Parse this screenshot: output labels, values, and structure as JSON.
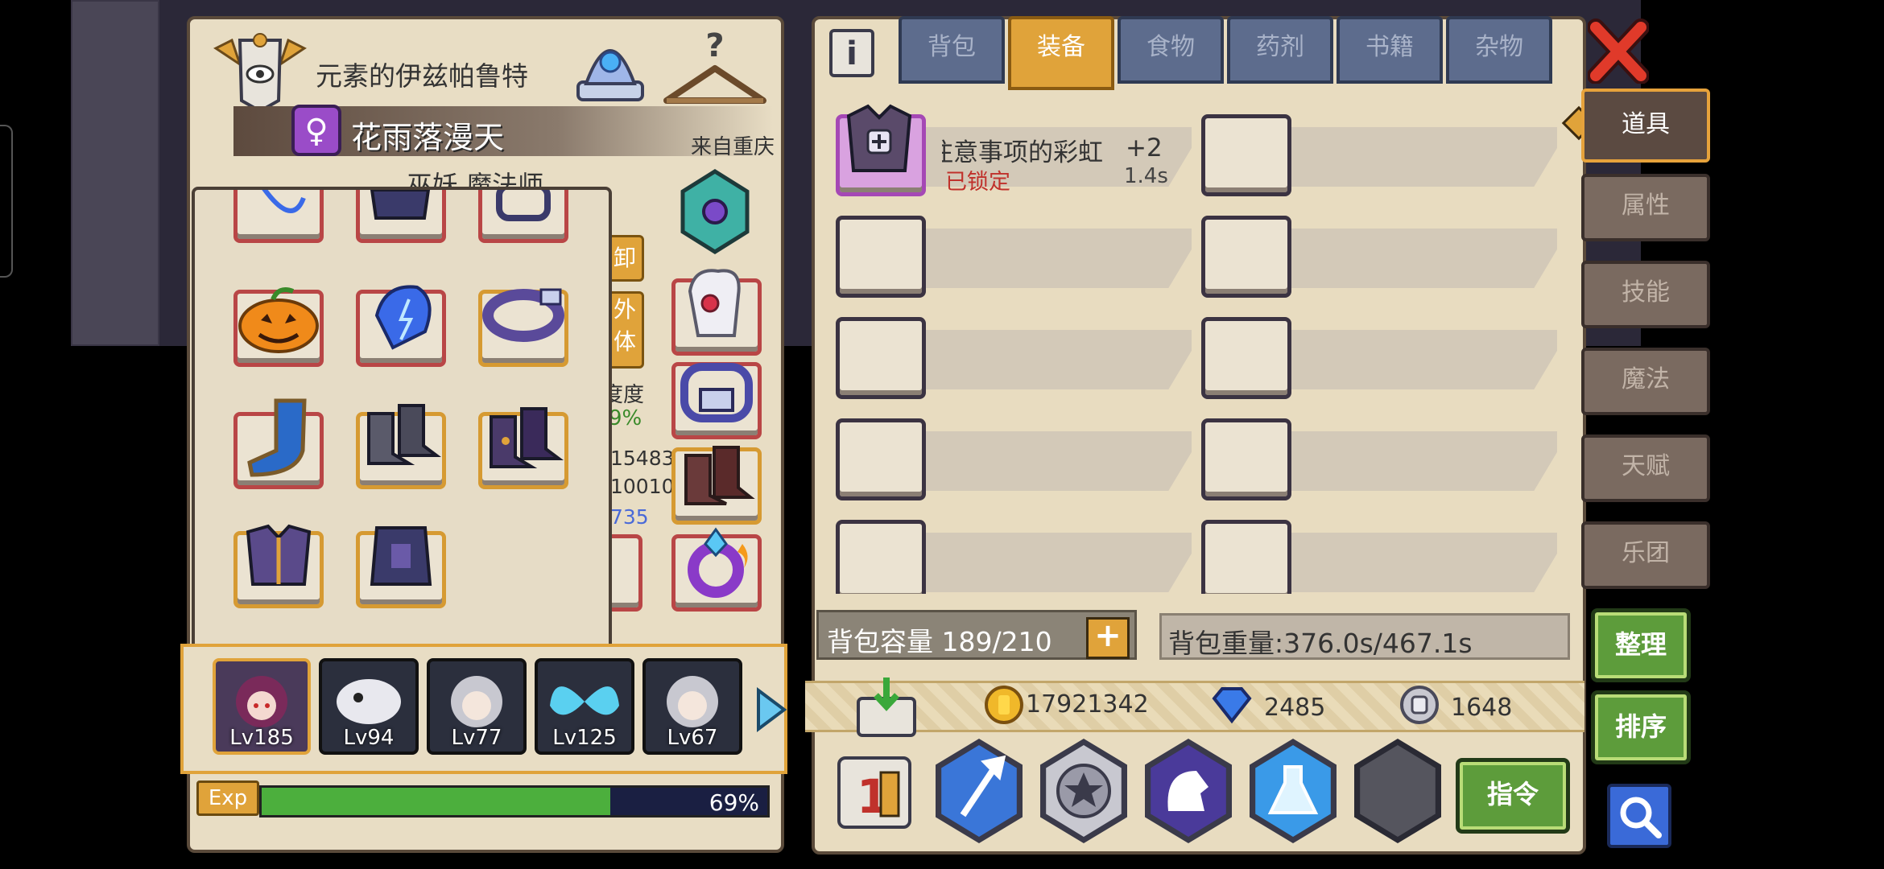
{
  "character": {
    "title": "元素的伊兹帕鲁特",
    "name": "花雨落漫天",
    "origin": "来自重庆",
    "class_partial": "巫妖 魔法师"
  },
  "partial_stats": {
    "unload_label": "卸",
    "appearance_label": "外\n体",
    "degree_label": "度度",
    "percent": "9%",
    "val1": "15483",
    "val2": "10010",
    "val3": "735"
  },
  "tabs": [
    {
      "label": "背包",
      "active": false
    },
    {
      "label": "装备",
      "active": true
    },
    {
      "label": "食物",
      "active": false
    },
    {
      "label": "药剂",
      "active": false
    },
    {
      "label": "书籍",
      "active": false
    },
    {
      "label": "杂物",
      "active": false
    }
  ],
  "side_menu": [
    {
      "label": "道具",
      "active": true
    },
    {
      "label": "属性",
      "active": false
    },
    {
      "label": "技能",
      "active": false
    },
    {
      "label": "魔法",
      "active": false
    },
    {
      "label": "天赋",
      "active": false
    },
    {
      "label": "乐团",
      "active": false
    }
  ],
  "item": {
    "name": "注意事项的彩虹』",
    "plus": "+2",
    "status": "已锁定",
    "weight": "1.4s"
  },
  "bag": {
    "capacity": "背包容量 189/210",
    "weight": "背包重量:376.0s/467.1s"
  },
  "currency": {
    "gold": "17921342",
    "gems": "2485",
    "silver": "1648"
  },
  "buttons": {
    "organize": "整理",
    "sort": "排序",
    "command": "指令",
    "close": "✕",
    "info": "i"
  },
  "party": [
    {
      "level": "Lv185"
    },
    {
      "level": "Lv94"
    },
    {
      "level": "Lv77"
    },
    {
      "level": "Lv125"
    },
    {
      "level": "Lv67"
    }
  ],
  "exp": {
    "label": "Exp",
    "percent_text": "69%",
    "fraction": 0.69
  },
  "colors": {
    "exp_green": "#4caf3d",
    "gold_text": "#e6a23b",
    "locked_red": "#c0312b"
  }
}
